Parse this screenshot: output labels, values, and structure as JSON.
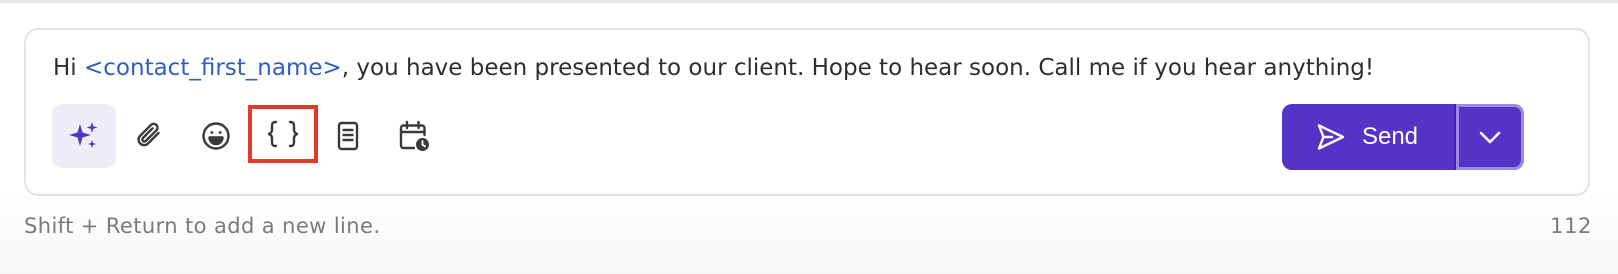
{
  "message": {
    "greeting": "Hi ",
    "token": "<contact_first_name>",
    "rest": ", you have been presented to our client. Hope to hear soon. Call me if you hear anything!"
  },
  "toolbar": {
    "buttons": [
      {
        "icon": "sparkles-icon",
        "active": true
      },
      {
        "icon": "paperclip-icon"
      },
      {
        "icon": "smiley-icon"
      },
      {
        "icon": "curly-braces-icon",
        "highlighted": true
      },
      {
        "icon": "document-icon"
      },
      {
        "icon": "calendar-clock-icon"
      }
    ]
  },
  "send": {
    "label": "Send",
    "icon": "paper-plane-icon",
    "options_icon": "chevron-down-icon"
  },
  "footer": {
    "hint": "Shift + Return to add a new line.",
    "count": "112"
  },
  "colors": {
    "accent": "#5433c6",
    "token": "#2f5fc4",
    "highlight_box": "#e23a2b",
    "ai_button_bg": "#eeecf9"
  }
}
